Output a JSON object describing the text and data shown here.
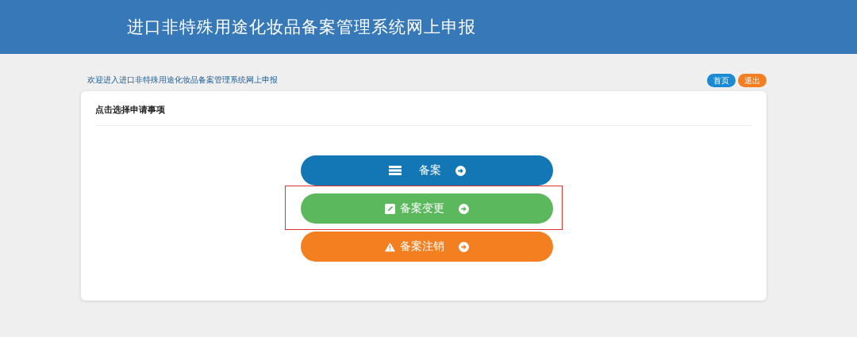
{
  "header": {
    "title": "进口非特殊用途化妆品备案管理系统网上申报"
  },
  "welcome": "欢迎进入进口非特殊用途化妆品备案管理系统网上申报",
  "nav_buttons": [
    {
      "label": "首页",
      "kind": "home"
    },
    {
      "label": "退出",
      "kind": "logout"
    }
  ],
  "card": {
    "title": "点击选择申请事项",
    "options": [
      {
        "label": "备案",
        "kind": "filing",
        "highlighted": false
      },
      {
        "label": "备案变更",
        "kind": "change",
        "highlighted": true
      },
      {
        "label": "备案注销",
        "kind": "cancel",
        "highlighted": false
      }
    ]
  }
}
